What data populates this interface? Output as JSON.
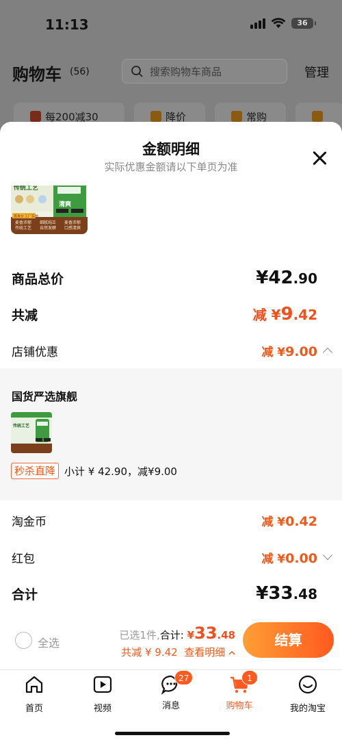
{
  "status_bar": {
    "time": "11:13",
    "battery": "36"
  },
  "cart_header": {
    "title": "购物车",
    "count": "(56)",
    "search_placeholder": "搜索购物车商品",
    "manage_label": "管理"
  },
  "filters": [
    {
      "label": "每200减30",
      "icon": "shop-icon"
    },
    {
      "label": "降价",
      "icon": "price-drop-icon"
    },
    {
      "label": "常购",
      "icon": "basket-icon"
    }
  ],
  "detail_sheet": {
    "title": "金额明细",
    "subtitle": "实际优惠金额请以下单页为准",
    "product_image_texts": [
      "传统工艺",
      "清爽",
      "麦香浓郁",
      "传统工艺",
      "细腻纯正",
      "自然发酵",
      "麦香浓郁",
      "口感清爽",
      "首发价",
      "工厂实拍"
    ],
    "rows": {
      "goods_total": {
        "label": "商品总价",
        "currency": "¥",
        "int": "42",
        "dec": ".90"
      },
      "total_discount": {
        "label": "共减",
        "prefix": "减 ¥",
        "int": "9",
        "dec": ".42"
      },
      "shop_discount": {
        "label": "店铺优惠",
        "prefix": "减 ¥",
        "value": "9.00"
      },
      "tao_coins": {
        "label": "淘金币",
        "prefix": "减 ¥",
        "value": "0.42"
      },
      "red_packet": {
        "label": "红包",
        "prefix": "减 ¥",
        "value": "0.00"
      },
      "sum": {
        "label": "合计",
        "currency": "¥",
        "int": "33",
        "dec": ".48"
      }
    },
    "shop": {
      "name": "国货严选旗舰",
      "promo_tag": "秒杀直降",
      "subtotal": "小计 ¥ 42.90，减¥9.00",
      "thumb_text": "传统工艺"
    }
  },
  "checkout": {
    "select_all": "全选",
    "selected_text": "已选1件,",
    "total_label": "合计:",
    "currency": "¥",
    "amount_int": "33",
    "amount_dec": ".48",
    "discount_text": "共减 ¥ 9.42",
    "view_detail": "查看明细",
    "pay_label": "结算"
  },
  "tabbar": [
    {
      "label": "首页",
      "icon": "home-icon"
    },
    {
      "label": "视频",
      "icon": "video-icon"
    },
    {
      "label": "消息",
      "icon": "message-icon",
      "badge": "27"
    },
    {
      "label": "购物车",
      "icon": "cart-icon",
      "badge": "1",
      "active": true
    },
    {
      "label": "我的淘宝",
      "icon": "profile-icon"
    }
  ],
  "colors": {
    "accent": "#ff5a1f",
    "discount": "#ee5a1b",
    "overlay": "#808080"
  }
}
